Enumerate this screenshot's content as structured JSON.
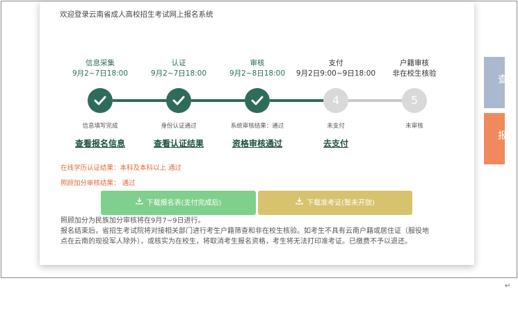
{
  "welcome": "欢迎登录云南省成人高校招生考试网上报名系统",
  "steps": [
    {
      "title": "信息采集",
      "time": "9月2~7日18:00",
      "status": "信息填写完成",
      "link": "查看报名信息",
      "state": "done"
    },
    {
      "title": "认证",
      "time": "9月2~7日18:00",
      "status": "身份认证通过",
      "link": "查看认证结果",
      "state": "done"
    },
    {
      "title": "审核",
      "time": "9月2~8日18:00",
      "status": "系统审核结果：通过",
      "link": "资格审核通过",
      "state": "done"
    },
    {
      "title": "支付",
      "time": "9月2日9:00~9日18:00",
      "status": "未支付",
      "link": "去支付",
      "number": "4",
      "state": "todo"
    },
    {
      "title": "户籍审核",
      "time": "非在校生核验",
      "status": "未审核",
      "number": "5",
      "state": "todo"
    }
  ],
  "results": {
    "education": "在线学历认证结果：本科及本科以上 通过",
    "bonus": "照顾加分审核结果： 通过"
  },
  "buttons": {
    "download_form": "下载报名表(支付完成后)",
    "download_ticket": "下载准考证(暂未开放)"
  },
  "notes": {
    "line1": "照顾加分为民族加分审核将在9月7~9日进行。",
    "line2": "报名结束后，省招生考试院将对接相关部门进行考生户籍筛查和非在校生核验。如考生不具有云南户籍或居住证（服役地",
    "line3": "点在云南的现役军人除外），或核实为在校生，将取消考生报名资格，考生将无法打印准考证。已缴费不予以退还。"
  },
  "side": {
    "tab1": "查",
    "tab2": "报"
  },
  "colors": {
    "done": "#2f6b5a",
    "todo": "#d9d9d9",
    "accent_orange": "#e36a3a",
    "btn_green": "#7fd08c",
    "btn_yellow": "#d7c36e"
  },
  "paragraph_mark": "↵"
}
